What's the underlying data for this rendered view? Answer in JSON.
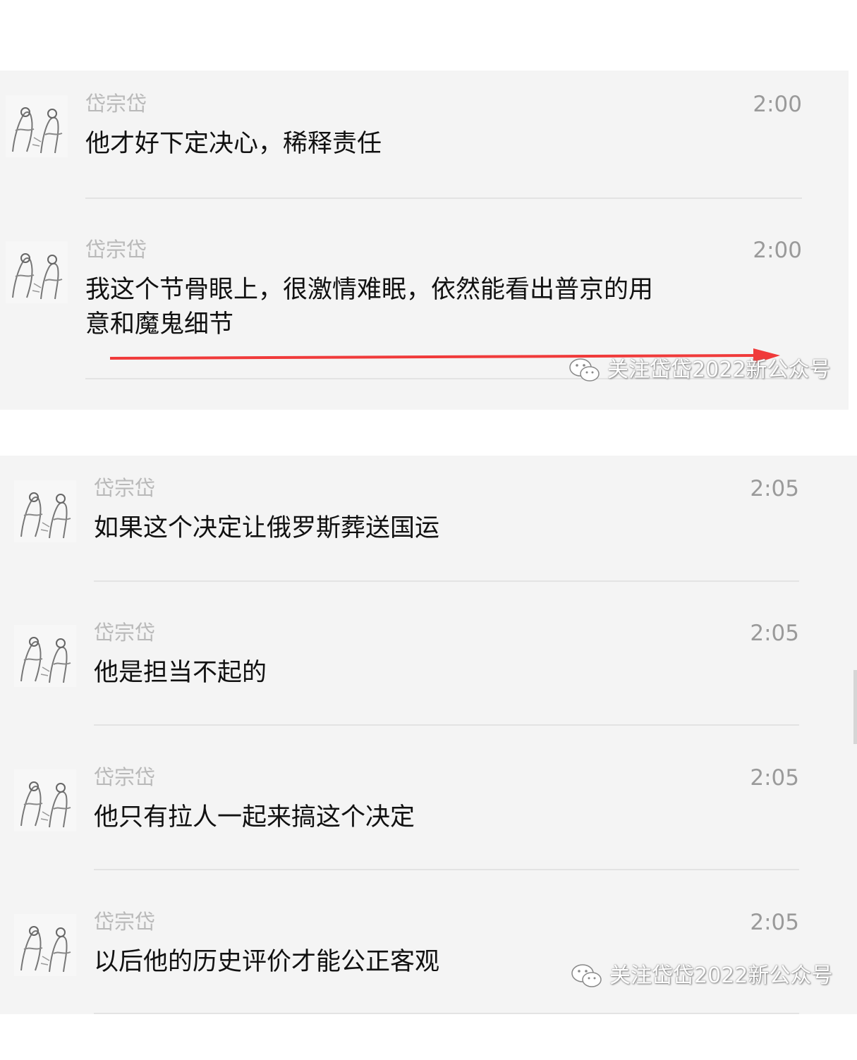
{
  "panel1": {
    "messages": [
      {
        "sender": "岱宗岱",
        "time": "2:00",
        "text": "他才好下定决心，稀释责任"
      },
      {
        "sender": "岱宗岱",
        "time": "2:00",
        "text_line1": "我这个节骨眼上，很激情难眠，依然能看出普京的用",
        "text_line2": "意和魔鬼细节"
      }
    ],
    "watermark": "关注岱岱2022新公众号"
  },
  "panel2": {
    "messages": [
      {
        "sender": "岱宗岱",
        "time": "2:05",
        "text": "如果这个决定让俄罗斯葬送国运"
      },
      {
        "sender": "岱宗岱",
        "time": "2:05",
        "text": "他是担当不起的"
      },
      {
        "sender": "岱宗岱",
        "time": "2:05",
        "text": "他只有拉人一起来搞这个决定"
      },
      {
        "sender": "岱宗岱",
        "time": "2:05",
        "text": "以后他的历史评价才能公正客观"
      }
    ],
    "watermark": "关注岱岱2022新公众号"
  },
  "colors": {
    "arrow": "#f03a3a",
    "panel_bg": "#f4f4f4"
  },
  "icons": {
    "avatar": "sketch-figures-avatar",
    "watermark": "wechat-icon"
  }
}
